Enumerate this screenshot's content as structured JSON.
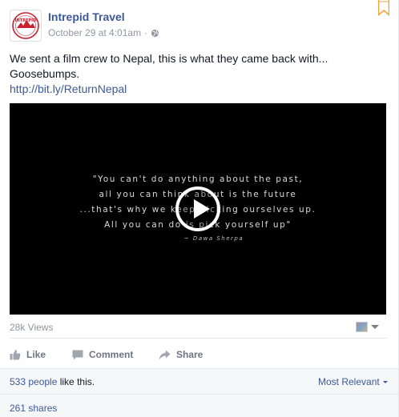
{
  "post": {
    "page_name": "Intrepid Travel",
    "timestamp": "October 29 at 4:01am",
    "separator": "·",
    "privacy_icon": "globe-icon",
    "avatar_logo_text": "INTREPID",
    "message_line1": "We sent a film crew to Nepal, this is what they came back with...",
    "message_line2": "Goosebumps.",
    "link": "http://bit.ly/ReturnNepal"
  },
  "video": {
    "quote_lines": [
      "\"You can't do anything about the past,",
      "all you can think about is the future",
      "...that's why we keep picking ourselves up.",
      "All you can do is pick yourself up\""
    ],
    "quote_author": "~ Dawa Sherpa",
    "play_icon": "play-icon",
    "views": "28k Views"
  },
  "actions": {
    "like": "Like",
    "comment": "Comment",
    "share": "Share"
  },
  "summary": {
    "likes_count": "533 people",
    "likes_suffix": " like this.",
    "sort_label": "Most Relevant",
    "shares": "261 shares"
  },
  "colors": {
    "link_blue": "#3b5998",
    "muted_gray": "#9197a3",
    "bookmark_orange": "#f7a33c",
    "avatar_red": "#c8202f"
  }
}
